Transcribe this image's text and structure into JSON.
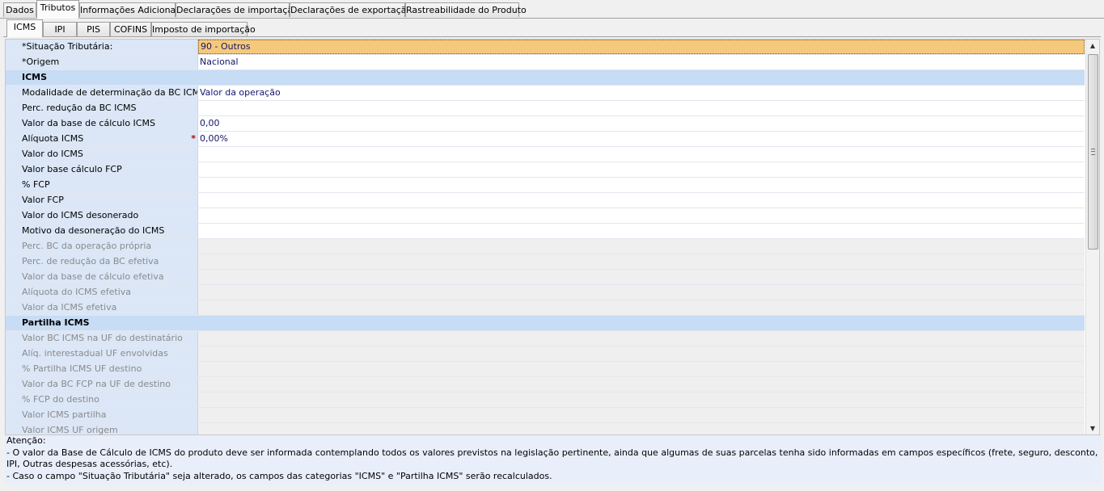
{
  "main_tabs": [
    "Dados",
    "Tributos",
    "Informações Adicionais",
    "Declarações de importação",
    "Declarações de exportação",
    "Rastreabilidade do Produto"
  ],
  "main_active": "Tributos",
  "sub_tabs": [
    "ICMS",
    "IPI",
    "PIS",
    "COFINS",
    "Imposto de importação"
  ],
  "sub_active": "ICMS",
  "grid": {
    "rows": [
      {
        "type": "field",
        "label": "*Situação Tributária:",
        "value": "90 - Outros",
        "selected": true
      },
      {
        "type": "field",
        "label": "*Origem",
        "value": "Nacional"
      },
      {
        "type": "category",
        "label": "ICMS"
      },
      {
        "type": "field",
        "label": "Modalidade de determinação da BC ICMS",
        "value": "Valor da operação"
      },
      {
        "type": "field",
        "label": "Perc. redução da BC ICMS",
        "value": ""
      },
      {
        "type": "field",
        "label": "Valor da base de cálculo ICMS",
        "value": "0,00"
      },
      {
        "type": "field",
        "label": "Alíquota ICMS",
        "value": "0,00%",
        "required": true
      },
      {
        "type": "field",
        "label": "Valor do ICMS",
        "value": ""
      },
      {
        "type": "field",
        "label": "Valor base cálculo FCP",
        "value": ""
      },
      {
        "type": "field",
        "label": "% FCP",
        "value": ""
      },
      {
        "type": "field",
        "label": "Valor FCP",
        "value": ""
      },
      {
        "type": "field",
        "label": "Valor do ICMS desonerado",
        "value": ""
      },
      {
        "type": "field",
        "label": "Motivo da desoneração do ICMS",
        "value": ""
      },
      {
        "type": "field",
        "label": "Perc. BC da operação própria",
        "value": "",
        "disabled": true
      },
      {
        "type": "field",
        "label": "Perc. de redução da BC efetiva",
        "value": "",
        "disabled": true
      },
      {
        "type": "field",
        "label": "Valor da base de cálculo efetiva",
        "value": "",
        "disabled": true
      },
      {
        "type": "field",
        "label": "Alíquota do ICMS efetiva",
        "value": "",
        "disabled": true
      },
      {
        "type": "field",
        "label": "Valor da ICMS efetiva",
        "value": "",
        "disabled": true
      },
      {
        "type": "category",
        "label": "Partilha ICMS"
      },
      {
        "type": "field",
        "label": "Valor BC ICMS na UF do destinatário",
        "value": "",
        "disabled": true
      },
      {
        "type": "field",
        "label": "Alíq. interestadual UF envolvidas",
        "value": "",
        "disabled": true
      },
      {
        "type": "field",
        "label": "% Partilha ICMS UF destino",
        "value": "",
        "disabled": true
      },
      {
        "type": "field",
        "label": "Valor da BC FCP na UF de destino",
        "value": "",
        "disabled": true
      },
      {
        "type": "field",
        "label": "% FCP do destino",
        "value": "",
        "disabled": true
      },
      {
        "type": "field",
        "label": "Valor ICMS partilha",
        "value": "",
        "disabled": true
      },
      {
        "type": "field",
        "label": "Valor ICMS UF origem",
        "value": "",
        "disabled": true
      }
    ],
    "required_marker": "*"
  },
  "info": {
    "title": "Atenção:",
    "line1": " - O valor da Base de Cálculo de ICMS do produto deve ser informada contemplando todos os valores previstos na legislação pertinente, ainda que algumas de suas parcelas tenha sido informadas em campos específicos (frete, seguro, desconto, IPI, Outras despesas acessórias, etc).",
    "line2": " - Caso o campo \"Situação Tributária\" seja alterado, os campos das categorias \"ICMS\" e \"Partilha ICMS\" serão recalculados."
  },
  "scrollbar": {
    "up_icon": "▲",
    "down_icon": "▼"
  }
}
